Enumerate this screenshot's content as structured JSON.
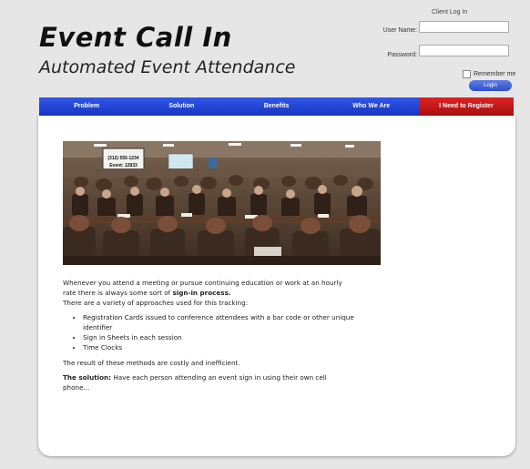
{
  "header": {
    "title": "Event Call In",
    "subtitle": "Automated Event Attendance"
  },
  "login": {
    "title": "Client Log In",
    "username_label": "User Name:",
    "password_label": "Password:",
    "remember_label": "Remember me",
    "login_button": "Login"
  },
  "nav": {
    "items": [
      {
        "label": "Problem"
      },
      {
        "label": "Solution"
      },
      {
        "label": "Benefits"
      },
      {
        "label": "Who We Are"
      },
      {
        "label": "I Need to Register"
      }
    ]
  },
  "photo": {
    "screen_line1": "(312) 555-1234",
    "screen_line2": "Event: 12833"
  },
  "content": {
    "intro_1a": "Whenever you attend a meeting or pursue continuing education or work at an hourly rate there is always some sort of ",
    "intro_1b": "sign-in process.",
    "intro_2": "There are a variety of approaches used for this tracking:",
    "bullets": [
      "Registration Cards issued to conference attendees with a bar code or other unique identifier",
      "Sign in Sheets in each session",
      "Time Clocks"
    ],
    "result": "The result of these methods are costly and inefficient.",
    "solution_label": "The solution:",
    "solution_text": " Have each person attending an event sign in using their own cell phone..."
  },
  "colors": {
    "nav_blue": "#2342d6",
    "nav_red": "#c41818",
    "background": "#e6e6e6"
  }
}
